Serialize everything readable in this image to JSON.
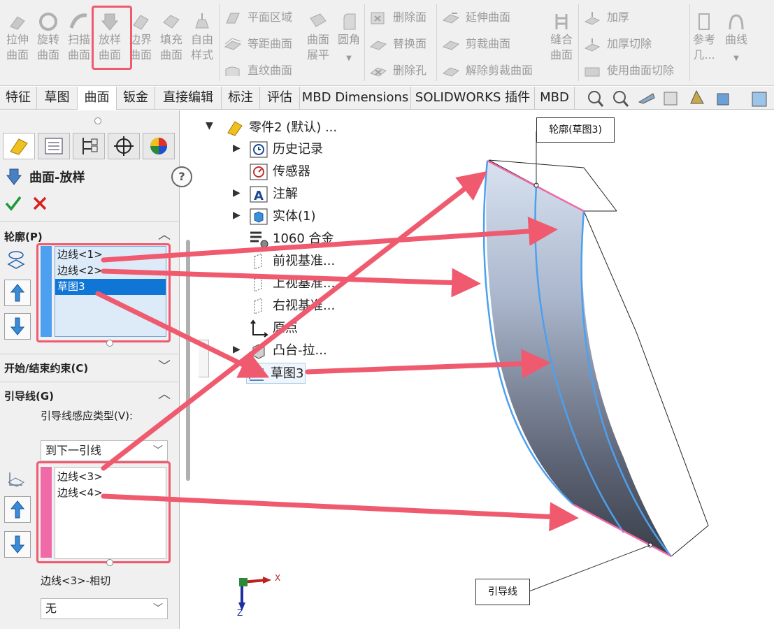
{
  "toolbar": {
    "large_buttons": [
      {
        "line1": "拉伸",
        "line2": "曲面"
      },
      {
        "line1": "旋转",
        "line2": "曲面"
      },
      {
        "line1": "扫描",
        "line2": "曲面"
      },
      {
        "line1": "放样",
        "line2": "曲面"
      },
      {
        "line1": "边界",
        "line2": "曲面"
      },
      {
        "line1": "填充",
        "line2": "曲面"
      },
      {
        "line1": "自由",
        "line2": "样式"
      }
    ],
    "group2": [
      "平面区域",
      "等距曲面",
      "直纹曲面"
    ],
    "flatten": {
      "line1": "曲面",
      "line2": "展平"
    },
    "fillet": "圆角",
    "group3": [
      "删除面",
      "替换面",
      "删除孔"
    ],
    "group4": [
      "延伸曲面",
      "剪裁曲面",
      "解除剪裁曲面"
    ],
    "knit": {
      "line1": "缝合",
      "line2": "曲面"
    },
    "group5": [
      "加厚",
      "加厚切除",
      "使用曲面切除"
    ],
    "reference": {
      "line1": "参考",
      "line2": "几..."
    },
    "curves": "曲线"
  },
  "tabs": [
    "特征",
    "草图",
    "曲面",
    "钣金",
    "直接编辑",
    "标注",
    "评估",
    "MBD Dimensions",
    "SOLIDWORKS 插件",
    "MBD"
  ],
  "property_manager": {
    "title": "曲面-放样",
    "profile": {
      "header": "轮廓(P)",
      "items": [
        "边线<1>",
        "边线<2>",
        "草图3"
      ]
    },
    "start_end": {
      "header": "开始/结束约束(C)"
    },
    "guides": {
      "header": "引导线(G)",
      "influence_label": "引导线感应类型(V):",
      "influence_value": "到下一引线",
      "items": [
        "边线<3>",
        "边线<4>"
      ],
      "tangency_label": "边线<3>-相切",
      "tangency_value": "无"
    }
  },
  "feature_tree": {
    "root": "零件2 (默认) ...",
    "items": [
      "历史记录",
      "传感器",
      "注解",
      "实体(1)",
      "1060 合金",
      "前视基准...",
      "上视基准...",
      "右视基准...",
      "原点",
      "凸台-拉...",
      "草图3"
    ]
  },
  "viewport": {
    "callout_profile": "轮廓(草图3)",
    "callout_guide": "引导线",
    "axis_x": "X",
    "axis_z": "Z"
  },
  "colors": {
    "accent_blue": "#0f76d6",
    "annotation_red": "#ef5a6f",
    "profile_bar": "#4ca0ef",
    "guide_bar": "#f06aa8"
  }
}
